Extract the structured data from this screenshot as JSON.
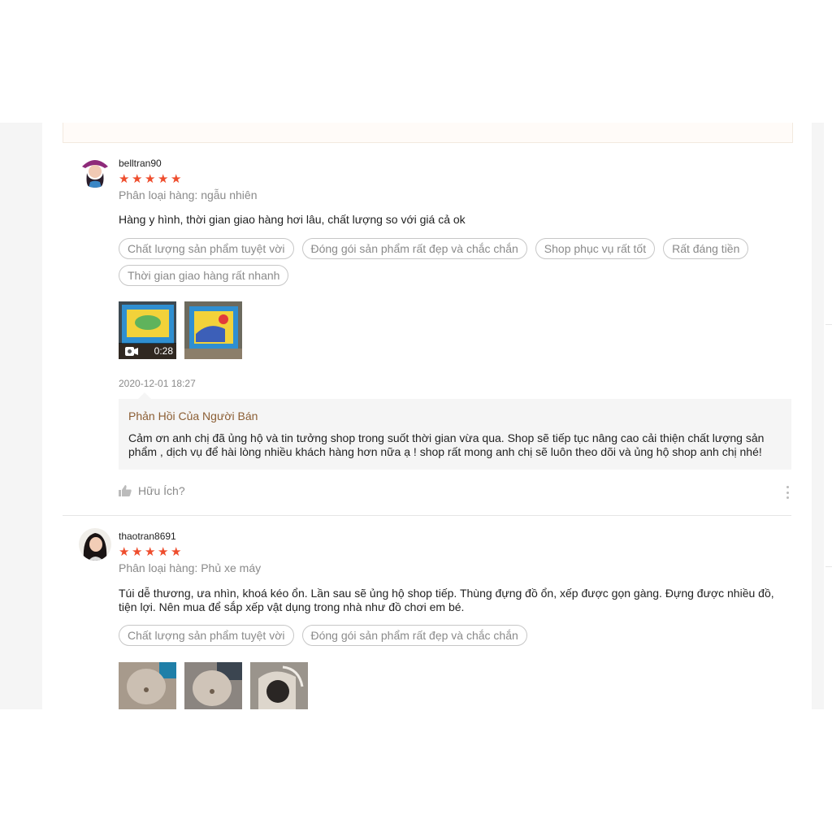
{
  "reviews": [
    {
      "username": "belltran90",
      "rating": 5,
      "variation": "Phân loại hàng: ngẫu nhiên",
      "comment": "Hàng y hình, thời gian giao hàng hơi lâu, chất lượng so với giá cả ok",
      "tags": [
        "Chất lượng sản phẩm tuyệt vời",
        "Đóng gói sản phẩm rất đẹp và chắc chắn",
        "Shop phục vụ rất tốt",
        "Rất đáng tiền",
        "Thời gian giao hàng rất nhanh"
      ],
      "video_duration": "0:28",
      "timestamp": "2020-12-01 18:27",
      "seller_reply": {
        "title": "Phản Hồi Của Người Bán",
        "text": "Cảm ơn anh chị đã ủng hộ và tin tưởng shop trong suốt thời gian vừa qua. Shop sẽ tiếp tục nâng cao cải thiện chất lượng sản phẩm , dịch vụ để hài lòng nhiều khách hàng hơn nữa ạ ! shop  rất mong anh chị sẽ luôn theo dõi và ủng hộ shop anh chị nhé!"
      },
      "helpful_label": "Hữu Ích?"
    },
    {
      "username": "thaotran8691",
      "rating": 5,
      "variation": "Phân loại hàng: Phủ xe máy",
      "comment": "Túi dễ thương, ưa nhìn, khoá kéo ổn. Lần sau sẽ ủng hộ shop tiếp. Thùng đựng đồ ổn, xếp được gọn gàng. Đựng được nhiều đồ, tiện lợi. Nên mua để sắp xếp vật dụng trong nhà như đồ chơi em bé.",
      "tags": [
        "Chất lượng sản phẩm tuyệt vời",
        "Đóng gói sản phẩm rất đẹp và chắc chắn"
      ]
    }
  ],
  "colors": {
    "star": "#ee4d2d",
    "reply_title": "#8b5e34",
    "muted": "#8a8a8a"
  },
  "icons": {
    "star": "star-icon",
    "helpful": "thumbs-up-icon",
    "more": "more-vertical-icon",
    "video": "video-camera-icon"
  }
}
